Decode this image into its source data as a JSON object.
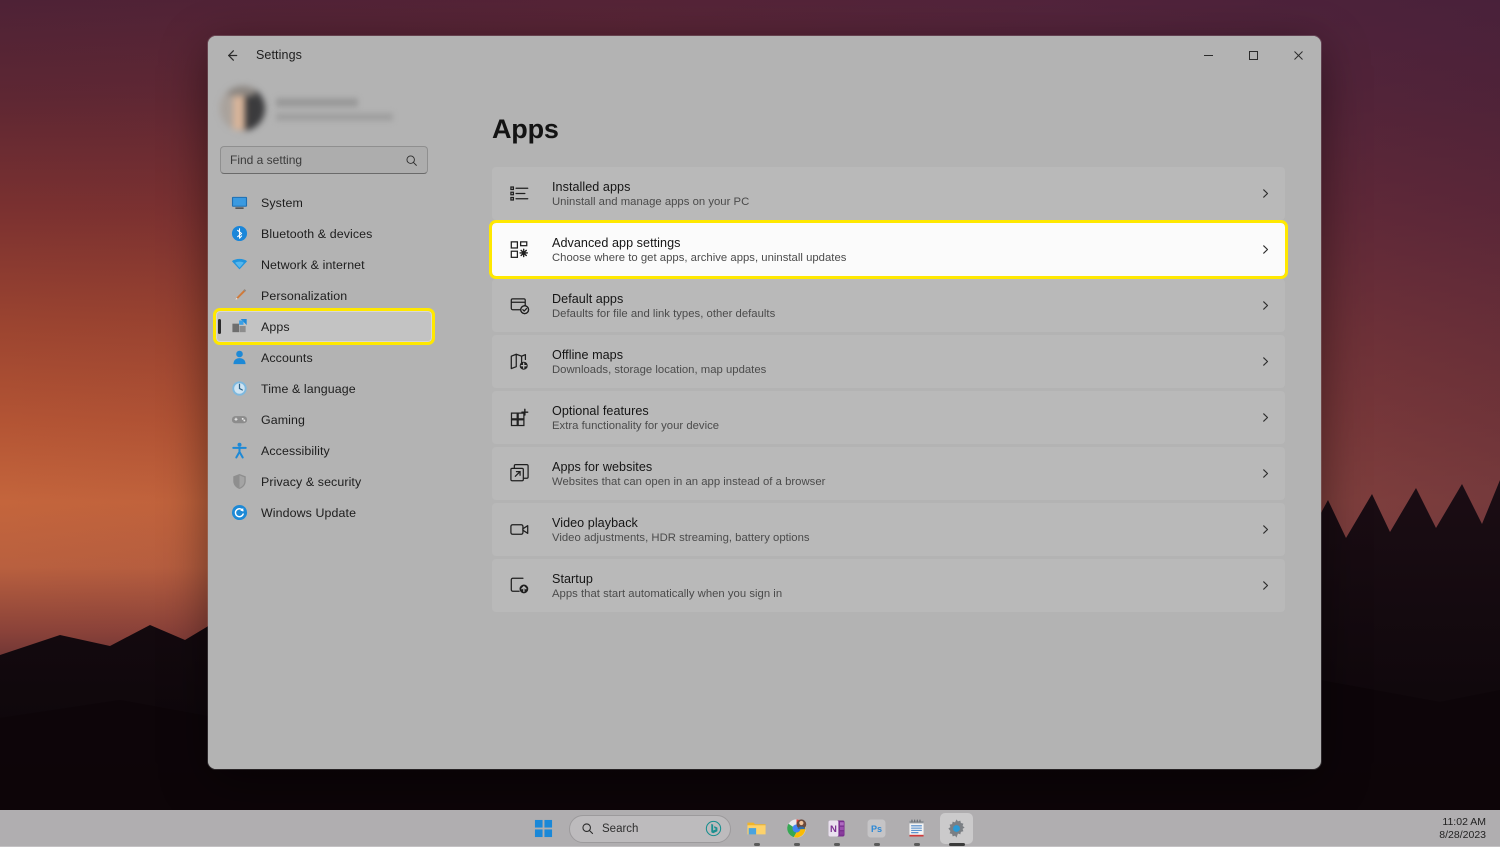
{
  "desktop": {
    "wallpaper_description": "sunset-forest-silhouette"
  },
  "window": {
    "title": "Settings",
    "back_icon": "back-arrow-icon",
    "controls": {
      "minimize": "–",
      "maximize": "☐",
      "close": "✕",
      "minimize_name": "minimize-button",
      "maximize_name": "maximize-button",
      "close_name": "close-button"
    }
  },
  "sidebar": {
    "profile": {
      "name": "",
      "email": "",
      "avatar_icon": "user-avatar"
    },
    "search": {
      "placeholder": "Find a setting",
      "value": "",
      "icon": "search-icon"
    },
    "items": [
      {
        "label": "System",
        "icon": "system-icon",
        "selected": false
      },
      {
        "label": "Bluetooth & devices",
        "icon": "bluetooth-icon",
        "selected": false
      },
      {
        "label": "Network & internet",
        "icon": "network-icon",
        "selected": false
      },
      {
        "label": "Personalization",
        "icon": "personalization-icon",
        "selected": false
      },
      {
        "label": "Apps",
        "icon": "apps-icon",
        "selected": true
      },
      {
        "label": "Accounts",
        "icon": "accounts-icon",
        "selected": false
      },
      {
        "label": "Time & language",
        "icon": "time-language-icon",
        "selected": false
      },
      {
        "label": "Gaming",
        "icon": "gaming-icon",
        "selected": false
      },
      {
        "label": "Accessibility",
        "icon": "accessibility-icon",
        "selected": false
      },
      {
        "label": "Privacy & security",
        "icon": "privacy-security-icon",
        "selected": false
      },
      {
        "label": "Windows Update",
        "icon": "windows-update-icon",
        "selected": false
      }
    ]
  },
  "main": {
    "title": "Apps",
    "cards": [
      {
        "title": "Installed apps",
        "subtitle": "Uninstall and manage apps on your PC",
        "icon": "installed-apps-icon",
        "highlighted": false
      },
      {
        "title": "Advanced app settings",
        "subtitle": "Choose where to get apps, archive apps, uninstall updates",
        "icon": "advanced-app-settings-icon",
        "highlighted": true
      },
      {
        "title": "Default apps",
        "subtitle": "Defaults for file and link types, other defaults",
        "icon": "default-apps-icon",
        "highlighted": false
      },
      {
        "title": "Offline maps",
        "subtitle": "Downloads, storage location, map updates",
        "icon": "offline-maps-icon",
        "highlighted": false
      },
      {
        "title": "Optional features",
        "subtitle": "Extra functionality for your device",
        "icon": "optional-features-icon",
        "highlighted": false
      },
      {
        "title": "Apps for websites",
        "subtitle": "Websites that can open in an app instead of a browser",
        "icon": "apps-for-websites-icon",
        "highlighted": false
      },
      {
        "title": "Video playback",
        "subtitle": "Video adjustments, HDR streaming, battery options",
        "icon": "video-playback-icon",
        "highlighted": false
      },
      {
        "title": "Startup",
        "subtitle": "Apps that start automatically when you sign in",
        "icon": "startup-icon",
        "highlighted": false
      }
    ],
    "chevron": "›"
  },
  "taskbar": {
    "start": "start-icon",
    "search": {
      "placeholder": "Search",
      "label": "Search",
      "icon": "search-icon",
      "bing_icon": "bing-chat-icon"
    },
    "apps": [
      {
        "name": "file-explorer",
        "label": "File Explorer",
        "active": false
      },
      {
        "name": "google-chrome",
        "label": "Google Chrome",
        "active": false
      },
      {
        "name": "onenote",
        "label": "OneNote",
        "active": false
      },
      {
        "name": "photoshop",
        "label": "Ps",
        "active": false
      },
      {
        "name": "notepad",
        "label": "Notepad",
        "active": false
      },
      {
        "name": "settings",
        "label": "Settings",
        "active": true
      }
    ],
    "clock": {
      "time": "11:02 AM",
      "date": "8/28/2023"
    }
  },
  "colors": {
    "highlight_yellow": "#ffe800",
    "window_bg": "#b3b3b3",
    "card_bg": "#b9b9b9",
    "card_highlight_bg": "#fbfbfb",
    "accent_blue": "#0a7bc4"
  }
}
